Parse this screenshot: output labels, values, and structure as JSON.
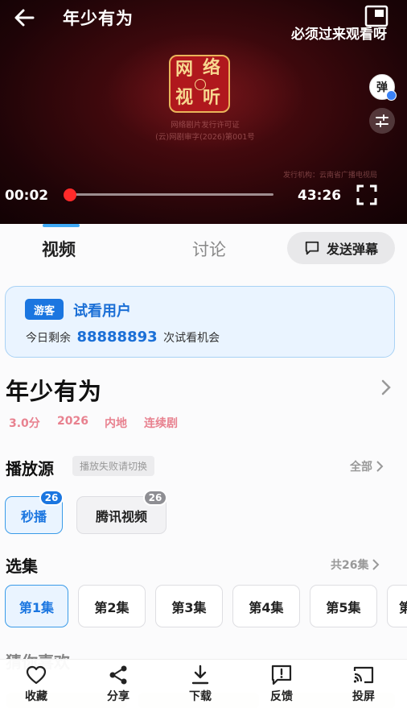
{
  "player": {
    "title": "年少有为",
    "danmu_scroll_text": "必须过来观看呀",
    "logo_chars": [
      "网",
      "络",
      "视",
      "听"
    ],
    "license_lines": [
      "网络剧片发行许可证",
      "(云)网剧审字(2026)第001号"
    ],
    "producer_text": "发行机构：云南省广播电视局",
    "danmu_toggle_label": "弹",
    "current_time": "00:02",
    "total_time": "43:26",
    "progress_fraction": 0.0008,
    "accent_color": "#ff2a2a"
  },
  "tabs": {
    "video": "视频",
    "discuss": "讨论",
    "send_danmu": "发送弹幕"
  },
  "guest": {
    "badge": "游客",
    "title": "试看用户",
    "trial_prefix": "今日剩余",
    "trial_count": "88888893",
    "trial_suffix": "次试看机会"
  },
  "show": {
    "title": "年少有为",
    "rating": "3.0分",
    "year": "2026",
    "region": "内地",
    "genre": "连续剧"
  },
  "sources": {
    "section_title": "播放源",
    "tip": "播放失败请切换",
    "more_label": "全部",
    "items": [
      {
        "label": "秒播",
        "count": "26",
        "badge_color": "#1b76e0"
      },
      {
        "label": "腾讯视频",
        "count": "26",
        "badge_color": "#8e8e93"
      }
    ]
  },
  "episodes": {
    "section_title": "选集",
    "total_label": "共26集",
    "items": [
      "第1集",
      "第2集",
      "第3集",
      "第4集",
      "第5集",
      "第"
    ]
  },
  "recommend": {
    "section_title": "猜你喜欢"
  },
  "bottom_bar": {
    "items": [
      {
        "label": "收藏",
        "icon": "heart-icon"
      },
      {
        "label": "分享",
        "icon": "share-icon"
      },
      {
        "label": "下载",
        "icon": "download-icon"
      },
      {
        "label": "反馈",
        "icon": "feedback-icon"
      },
      {
        "label": "投屏",
        "icon": "cast-icon"
      }
    ]
  }
}
